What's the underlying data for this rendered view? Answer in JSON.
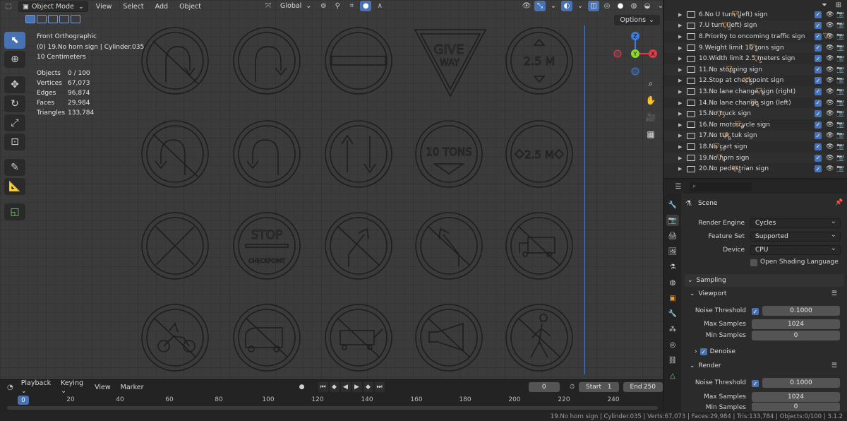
{
  "header": {
    "mode": "Object Mode",
    "menus": [
      "View",
      "Select",
      "Add",
      "Object"
    ],
    "transform_orientation": "Global",
    "options_label": "Options"
  },
  "viewport": {
    "view_name": "Front Orthographic",
    "object_info": "(0) 19.No horn sign | Cylinder.035",
    "scale": "10 Centimeters",
    "stats": [
      {
        "k": "Objects",
        "v": "0 / 100"
      },
      {
        "k": "Vertices",
        "v": "67,073"
      },
      {
        "k": "Edges",
        "v": "96,874"
      },
      {
        "k": "Faces",
        "v": "29,984"
      },
      {
        "k": "Triangles",
        "v": "133,784"
      }
    ],
    "gizmo": {
      "z": "Z",
      "y": "Y",
      "x": "X"
    },
    "sign_texts": {
      "give": "GIVE",
      "way": "WAY",
      "width_top": "2.5 M",
      "tons": "10 TONS",
      "width_mid": "2.5 M",
      "stop": "STOP",
      "checkpoint": "CHECKPOINT"
    }
  },
  "timeline": {
    "menus": [
      "Playback",
      "Keying",
      "View",
      "Marker"
    ],
    "current_frame": "0",
    "start_label": "Start",
    "start_value": "1",
    "end_label": "End",
    "end_value": "250",
    "ruler_current": "0",
    "ticks": [
      "20",
      "40",
      "60",
      "80",
      "100",
      "120",
      "140",
      "160",
      "180",
      "200",
      "220",
      "240"
    ]
  },
  "status_bar": "19.No horn sign | Cylinder.035 | Verts:67,073 | Faces:29,984 | Tris:133,784 | Objects:0/100 | 3.1.2",
  "outliner": {
    "rows": [
      {
        "name": "6.No U turn (left) sign",
        "count": "4"
      },
      {
        "name": "7.U turn (left) sign",
        "count": "3"
      },
      {
        "name": "8.Priority to oncoming traffic sign",
        "count": ""
      },
      {
        "name": "9.Weight limit 10 tons sign",
        "count": "4"
      },
      {
        "name": "10.Width limit 2.5 meters sign",
        "count": "5"
      },
      {
        "name": "11.No stopping sign",
        "count": "4"
      },
      {
        "name": "12.Stop at checkpoint sign",
        "count": "5"
      },
      {
        "name": "13.No lane change sign (right)",
        "count": "6"
      },
      {
        "name": "14.No lane change sign (left)",
        "count": "6"
      },
      {
        "name": "15.No truck sign",
        "count": "7"
      },
      {
        "name": "16.No motorcycle sign",
        "count": "8"
      },
      {
        "name": "17.No tuk tuk sign",
        "count": "8"
      },
      {
        "name": "18.No cart sign",
        "count": "10"
      },
      {
        "name": "19.No horn sign",
        "count": "4"
      },
      {
        "name": "20.No pedestrian sign",
        "count": "4"
      }
    ]
  },
  "properties": {
    "scene_label": "Scene",
    "render_engine_label": "Render Engine",
    "render_engine": "Cycles",
    "feature_set_label": "Feature Set",
    "feature_set": "Supported",
    "device_label": "Device",
    "device": "CPU",
    "osl_label": "Open Shading Language",
    "sampling_label": "Sampling",
    "viewport_label": "Viewport",
    "vp_noise_label": "Noise Threshold",
    "vp_noise": "0.1000",
    "vp_max_label": "Max Samples",
    "vp_max": "1024",
    "vp_min_label": "Min Samples",
    "vp_min": "0",
    "denoise_label": "Denoise",
    "render_label": "Render",
    "r_noise_label": "Noise Threshold",
    "r_noise": "0.1000",
    "r_max_label": "Max Samples",
    "r_max": "1024",
    "r_min_label": "Min Samples",
    "r_min": "0"
  },
  "colors": {
    "accent": "#4772b3",
    "x_axis": "#e23b47",
    "y_axis": "#8bdc2a",
    "z_axis": "#3c7de0",
    "object_orange": "#e49a4b"
  }
}
